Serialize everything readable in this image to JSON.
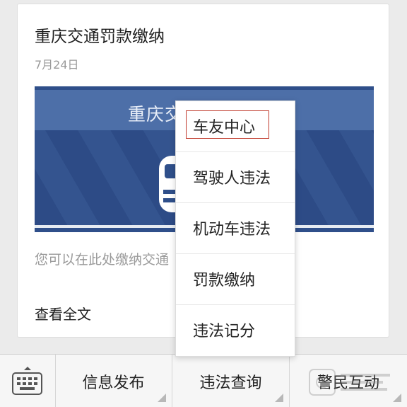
{
  "article": {
    "title": "重庆交通罚款缴纳",
    "date": "7月24日",
    "banner_title": "重庆交",
    "summary": "您可以在此处缴纳交通",
    "read_more": "查看全文"
  },
  "popup_menu": {
    "items": [
      {
        "label": "车友中心"
      },
      {
        "label": "驾驶人违法"
      },
      {
        "label": "机动车违法"
      },
      {
        "label": "罚款缴纳"
      },
      {
        "label": "违法记分"
      }
    ],
    "selected_index": 0
  },
  "bottom_bar": {
    "keyboard_icon": "keyboard-icon",
    "menus": [
      {
        "label": "信息发布"
      },
      {
        "label": "违法查询"
      },
      {
        "label": "警民互动"
      }
    ]
  },
  "colors": {
    "highlight": "#c0392b",
    "banner": "#2f4f8a"
  }
}
